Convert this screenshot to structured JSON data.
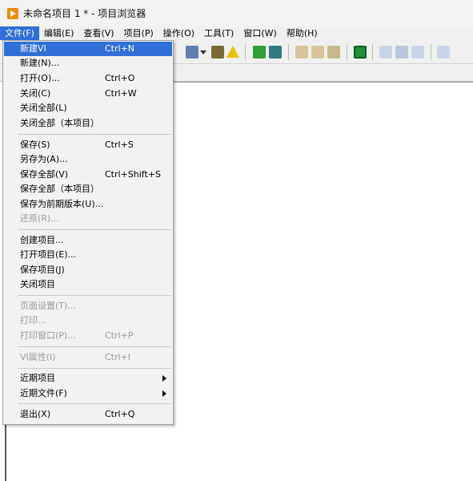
{
  "window": {
    "title": "未命名项目 1 * - 项目浏览器"
  },
  "menubar": {
    "items": [
      "文件(F)",
      "编辑(E)",
      "查看(V)",
      "项目(P)",
      "操作(O)",
      "工具(T)",
      "窗口(W)",
      "帮助(H)"
    ]
  },
  "file_menu": {
    "new_vi": {
      "label": "新建VI",
      "shortcut": "Ctrl+N"
    },
    "new": {
      "label": "新建(N)..."
    },
    "open": {
      "label": "打开(O)...",
      "shortcut": "Ctrl+O"
    },
    "close": {
      "label": "关闭(C)",
      "shortcut": "Ctrl+W"
    },
    "close_all": {
      "label": "关闭全部(L)"
    },
    "close_all_project": {
      "label": "关闭全部（本项目）"
    },
    "save": {
      "label": "保存(S)",
      "shortcut": "Ctrl+S"
    },
    "save_as": {
      "label": "另存为(A)..."
    },
    "save_all": {
      "label": "保存全部(V)",
      "shortcut": "Ctrl+Shift+S"
    },
    "save_all_project": {
      "label": "保存全部（本项目）"
    },
    "save_previous": {
      "label": "保存为前期版本(U)..."
    },
    "revert": {
      "label": "还原(R)..."
    },
    "create_project": {
      "label": "创建项目..."
    },
    "open_project": {
      "label": "打开项目(E)..."
    },
    "save_project": {
      "label": "保存项目(J)"
    },
    "close_project": {
      "label": "关闭项目"
    },
    "page_setup": {
      "label": "页面设置(T)..."
    },
    "print": {
      "label": "打印..."
    },
    "print_window": {
      "label": "打印窗口(P)...",
      "shortcut": "Ctrl+P"
    },
    "vi_properties": {
      "label": "VI属性(I)",
      "shortcut": "Ctrl+I"
    },
    "recent_projects": {
      "label": "近期项目"
    },
    "recent_files": {
      "label": "近期文件(F)"
    },
    "exit": {
      "label": "退出(X)",
      "shortcut": "Ctrl+Q"
    }
  },
  "colors": {
    "highlight": "#2f6fd6",
    "disabled_text": "#9a9a9a",
    "app_icon": "#f08c00"
  }
}
